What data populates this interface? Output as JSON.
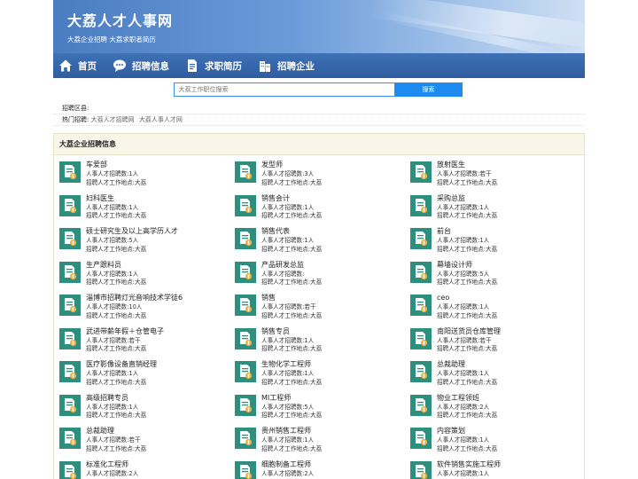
{
  "site": {
    "title": "大荔人才人事网",
    "subtitle": "大荔企业招聘 大荔求职者简历"
  },
  "nav": [
    {
      "label": "首页",
      "icon": "home-icon"
    },
    {
      "label": "招聘信息",
      "icon": "chat-icon"
    },
    {
      "label": "求职简历",
      "icon": "document-icon"
    },
    {
      "label": "招聘企业",
      "icon": "building-icon"
    }
  ],
  "search": {
    "placeholder": "大荔工作职位搜索",
    "button_label": "搜索"
  },
  "region": {
    "label": "招聘区县:"
  },
  "hot": {
    "label": "热门招聘:",
    "links": [
      "大荔人才招聘网",
      "大荔人事人才网"
    ]
  },
  "panel": {
    "title": "大荔企业招聘信息"
  },
  "jobs": [
    {
      "title": "车爱部",
      "count": "人事人才招聘数:1人",
      "location": "招聘人才工作地点:大荔"
    },
    {
      "title": "发型师",
      "count": "人事人才招聘数:3人",
      "location": "招聘人才工作地点:大荔"
    },
    {
      "title": "放射医生",
      "count": "人事人才招聘数:若干",
      "location": "招聘人才工作地点:大荔"
    },
    {
      "title": "妇科医生",
      "count": "人事人才招聘数:1人",
      "location": "招聘人才工作地点:大荔"
    },
    {
      "title": "销售会计",
      "count": "人事人才招聘数:1人",
      "location": "招聘人才工作地点:大荔"
    },
    {
      "title": "采购总监",
      "count": "人事人才招聘数:1人",
      "location": "招聘人才工作地点:大荔"
    },
    {
      "title": "硕士研究生及以上高学历人才",
      "count": "人事人才招聘数:5人",
      "location": "招聘人才工作地点:大荔"
    },
    {
      "title": "销售代表",
      "count": "人事人才招聘数:1人",
      "location": "招聘人才工作地点:大荔"
    },
    {
      "title": "前台",
      "count": "人事人才招聘数:1人",
      "location": "招聘人才工作地点:大荔"
    },
    {
      "title": "生产跟料员",
      "count": "人事人才招聘数:1人",
      "location": "招聘人才工作地点:大荔"
    },
    {
      "title": "产品研发总监",
      "count": "人事人才招聘数:",
      "location": "招聘人才工作地点:大荔"
    },
    {
      "title": "幕墙设计师",
      "count": "人事人才招聘数:5人",
      "location": "招聘人才工作地点:大荔"
    },
    {
      "title": "淄博市招聘灯光音响技术学徒6",
      "count": "人事人才招聘数:10人",
      "location": "招聘人才工作地点:大荔"
    },
    {
      "title": "销售",
      "count": "人事人才招聘数:若干",
      "location": "招聘人才工作地点:大荔"
    },
    {
      "title": "ceo",
      "count": "人事人才招聘数:1人",
      "location": "招聘人才工作地点:大荔"
    },
    {
      "title": "武进带薪年假＋仓管电子",
      "count": "人事人才招聘数:若干",
      "location": "招聘人才工作地点:大荔"
    },
    {
      "title": "销售专员",
      "count": "人事人才招聘数:1人",
      "location": "招聘人才工作地点:大荔"
    },
    {
      "title": "南阳送货员仓库管理",
      "count": "人事人才招聘数:若干",
      "location": "招聘人才工作地点:大荔"
    },
    {
      "title": "医疗影像设备直销经理",
      "count": "人事人才招聘数:1人",
      "location": "招聘人才工作地点:大荔"
    },
    {
      "title": "生物化学工程师",
      "count": "人事人才招聘数:1人",
      "location": "招聘人才工作地点:大荔"
    },
    {
      "title": "总裁助理",
      "count": "人事人才招聘数:1人",
      "location": "招聘人才工作地点:大荔"
    },
    {
      "title": "高级招聘专员",
      "count": "人事人才招聘数:1人",
      "location": "招聘人才工作地点:大荔"
    },
    {
      "title": "MI工程师",
      "count": "人事人才招聘数:5人",
      "location": "招聘人才工作地点:大荔"
    },
    {
      "title": "物业工程领班",
      "count": "人事人才招聘数:2人",
      "location": "招聘人才工作地点:大荔"
    },
    {
      "title": "总裁助理",
      "count": "人事人才招聘数:若干",
      "location": "招聘人才工作地点:大荔"
    },
    {
      "title": "贵州销售工程师",
      "count": "人事人才招聘数:1人",
      "location": "招聘人才工作地点:大荔"
    },
    {
      "title": "内容策划",
      "count": "人事人才招聘数:1人",
      "location": "招聘人才工作地点:大荔"
    },
    {
      "title": "标准化工程师",
      "count": "人事人才招聘数:2人",
      "location": ""
    },
    {
      "title": "细胞制备工程师",
      "count": "人事人才招聘数:2人",
      "location": ""
    },
    {
      "title": "软件销售实施工程师",
      "count": "人事人才招聘数:1人",
      "location": ""
    }
  ],
  "colors": {
    "banner": "#5a8bcc",
    "nav": "#3668ad",
    "search_button": "#1e8bf0",
    "job_icon": "#2f8f7e",
    "panel_head": "#f7f6e9"
  }
}
